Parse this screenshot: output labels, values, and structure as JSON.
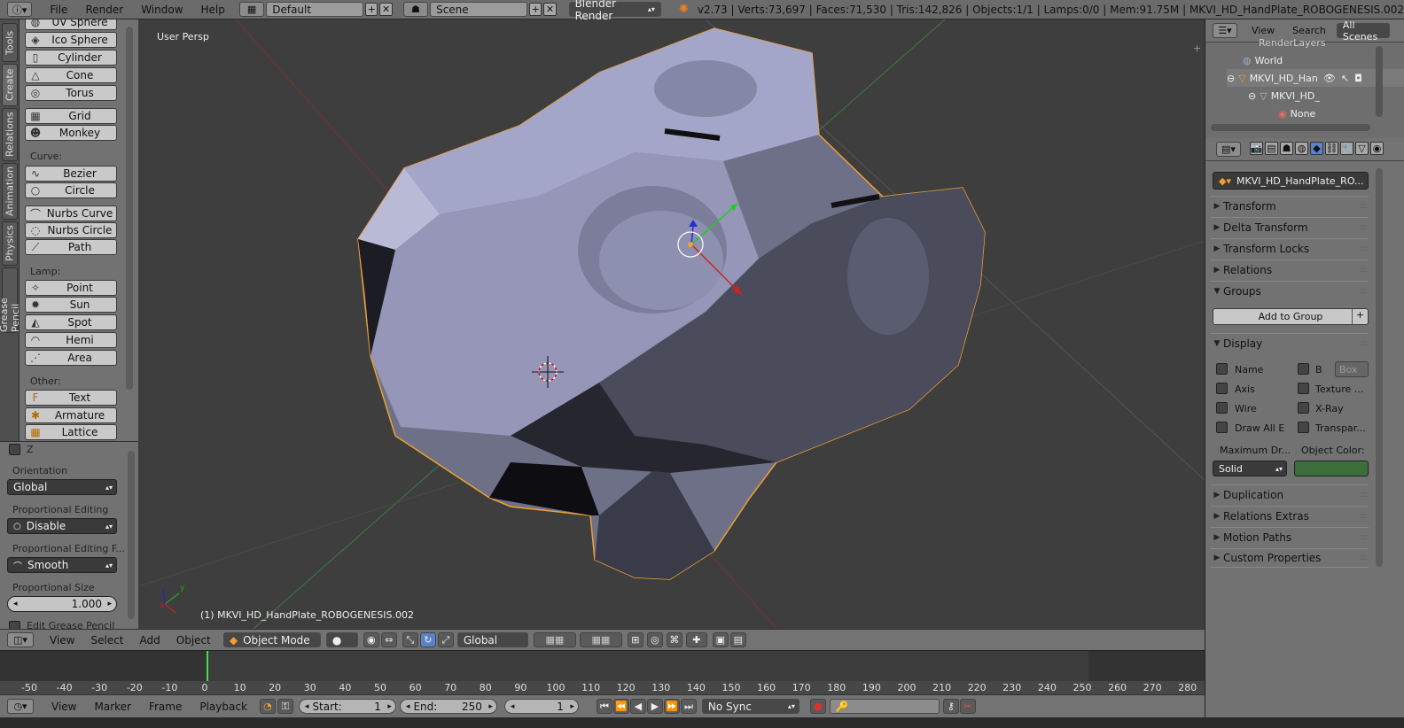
{
  "topbar": {
    "menus": [
      "File",
      "Render",
      "Window",
      "Help"
    ],
    "screen_layout": "Default",
    "scene": "Scene",
    "render_engine": "Blender Render",
    "stats": "v2.73 | Verts:73,697 | Faces:71,530 | Tris:142,826 | Objects:1/1 | Lamps:0/0 | Mem:91.75M | MKVI_HD_HandPlate_ROBOGENESIS.002"
  },
  "vtabs": [
    "Tools",
    "Create",
    "Relations",
    "Animation",
    "Physics",
    "Grease Pencil"
  ],
  "toolshelf": {
    "mesh_items": [
      "UV Sphere",
      "Ico Sphere",
      "Cylinder",
      "Cone",
      "Torus"
    ],
    "mesh_items2": [
      "Grid",
      "Monkey"
    ],
    "curve_label": "Curve:",
    "curve_items": [
      "Bezier",
      "Circle"
    ],
    "curve_items2": [
      "Nurbs Curve",
      "Nurbs Circle",
      "Path"
    ],
    "lamp_label": "Lamp:",
    "lamp_items": [
      "Point",
      "Sun",
      "Spot",
      "Hemi",
      "Area"
    ],
    "other_label": "Other:",
    "other_items": [
      "Text",
      "Armature",
      "Lattice"
    ]
  },
  "operator": {
    "z_label": "Z",
    "orientation_label": "Orientation",
    "orientation_value": "Global",
    "prop_edit_label": "Proportional Editing",
    "prop_edit_value": "Disable",
    "prop_falloff_label": "Proportional Editing F...",
    "prop_falloff_value": "Smooth",
    "prop_size_label": "Proportional Size",
    "prop_size_value": "1.000",
    "edit_gp_label": "Edit Grease Pencil"
  },
  "viewport": {
    "view_name": "User Persp",
    "object_label": "(1) MKVI_HD_HandPlate_ROBOGENESIS.002",
    "mesh_colors": {
      "light": "#9a9cc0",
      "mid": "#6e7088",
      "dark": "#2a2b34",
      "outline": "#f0a030"
    }
  },
  "v3dheader": {
    "menus": [
      "View",
      "Select",
      "Add",
      "Object"
    ],
    "mode": "Object Mode",
    "orientation": "Global"
  },
  "timeline": {
    "ticks": [
      "-50",
      "-40",
      "-30",
      "-20",
      "-10",
      "0",
      "10",
      "20",
      "30",
      "40",
      "50",
      "60",
      "70",
      "80",
      "90",
      "100",
      "110",
      "120",
      "130",
      "140",
      "150",
      "160",
      "170",
      "180",
      "190",
      "200",
      "210",
      "220",
      "230",
      "240",
      "250",
      "260",
      "270",
      "280"
    ],
    "menus": [
      "View",
      "Marker",
      "Frame",
      "Playback"
    ],
    "start_label": "Start:",
    "start_value": "1",
    "end_label": "End:",
    "end_value": "250",
    "current_frame": "1",
    "sync": "No Sync"
  },
  "outliner": {
    "view_menu": "View",
    "search_menu": "Search",
    "filter": "All Scenes",
    "rows": [
      "RenderLayers",
      "World",
      "MKVI_HD_Han",
      "MKVI_HD_",
      "None"
    ]
  },
  "properties": {
    "object_name": "MKVI_HD_HandPlate_RO...",
    "panels_top": [
      "Transform",
      "Delta Transform",
      "Transform Locks",
      "Relations"
    ],
    "groups_label": "Groups",
    "add_to_group": "Add to Group",
    "display_label": "Display",
    "display_checks_left": [
      "Name",
      "Axis",
      "Wire",
      "Draw All E"
    ],
    "display_checks_right": [
      "B",
      "Texture ...",
      "X-Ray",
      "Transpar..."
    ],
    "bounds_value": "Box",
    "max_draw_label": "Maximum Dr...",
    "object_color_label": "Object Color:",
    "max_draw_value": "Solid",
    "object_color": "#3c6e3c",
    "panels_bottom": [
      "Duplication",
      "Relations Extras",
      "Motion Paths",
      "Custom Properties"
    ]
  }
}
